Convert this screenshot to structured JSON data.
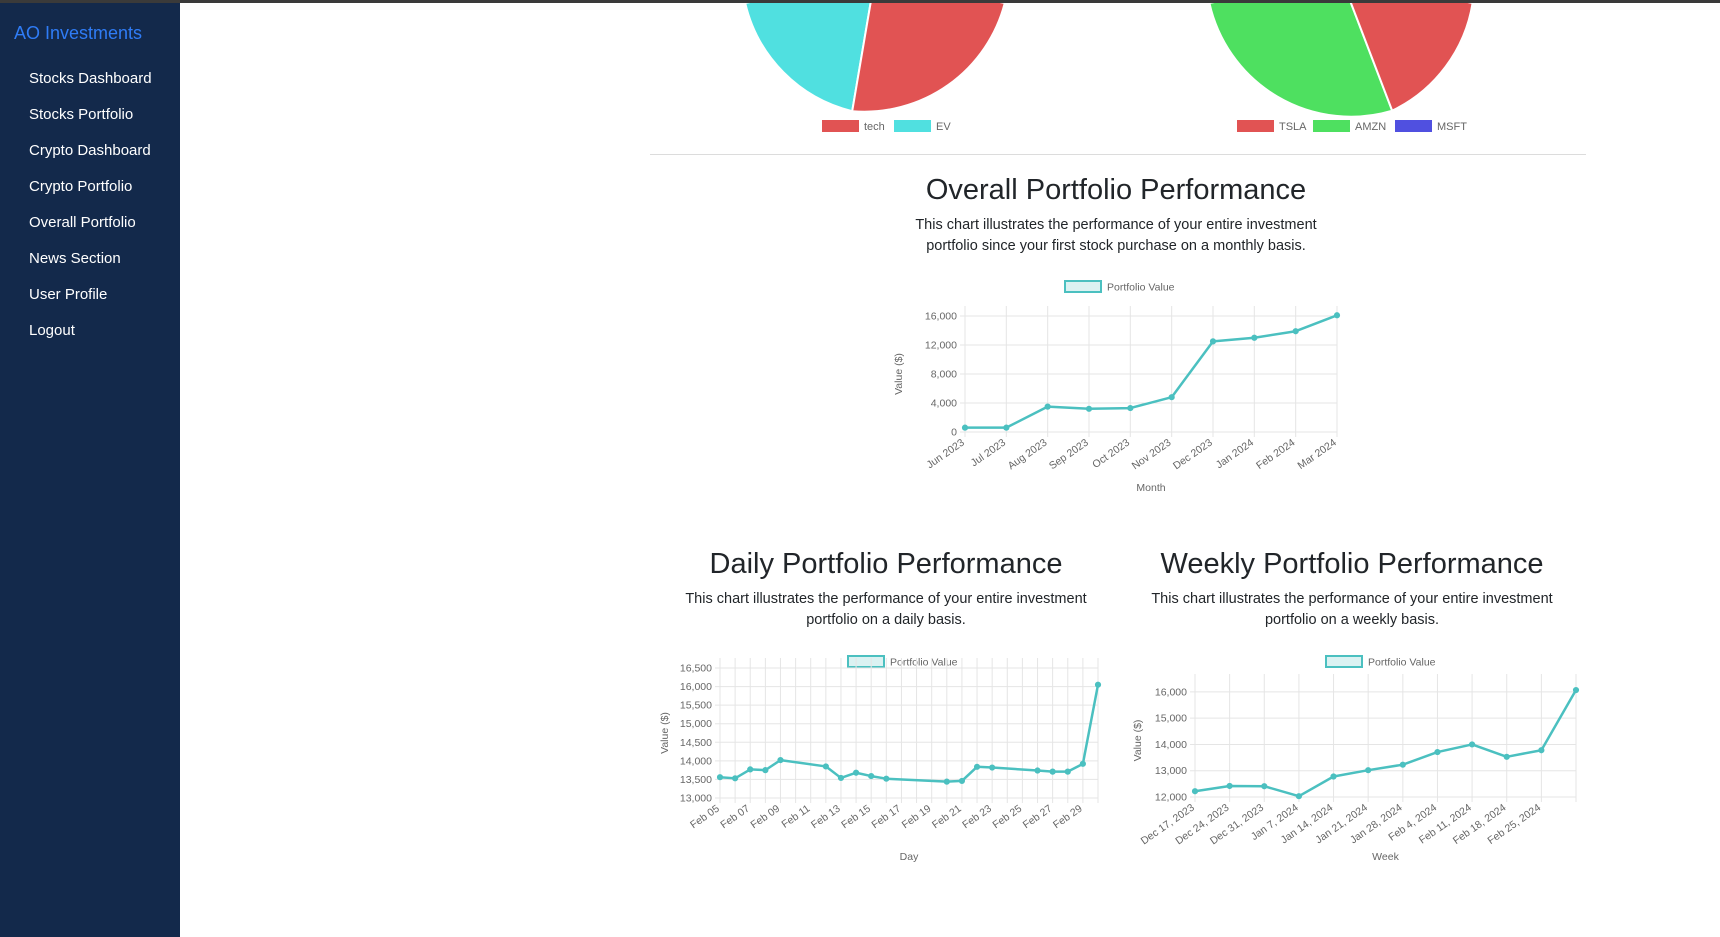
{
  "sidebar": {
    "brand": "AO Investments",
    "items": [
      {
        "label": "Stocks Dashboard"
      },
      {
        "label": "Stocks Portfolio"
      },
      {
        "label": "Crypto Dashboard"
      },
      {
        "label": "Crypto Portfolio"
      },
      {
        "label": "Overall Portfolio"
      },
      {
        "label": "News Section"
      },
      {
        "label": "User Profile"
      },
      {
        "label": "Logout"
      }
    ]
  },
  "colors": {
    "sidebar_bg": "#13294b",
    "brand": "#2f7cf6",
    "line": "#4bc0c0",
    "pie_red": "#e15353",
    "pie_cyan": "#50e0e0",
    "pie_green": "#4ee060",
    "pie_blue": "#5050e0"
  },
  "pie_legends": {
    "left": [
      {
        "label": "tech",
        "color": "#e15353"
      },
      {
        "label": "EV",
        "color": "#50e0e0"
      }
    ],
    "right": [
      {
        "label": "TSLA",
        "color": "#e15353"
      },
      {
        "label": "AMZN",
        "color": "#4ee060"
      },
      {
        "label": "MSFT",
        "color": "#5050e0"
      }
    ]
  },
  "sections": {
    "overall": {
      "title": "Overall Portfolio Performance",
      "desc": "This chart illustrates the performance of your entire investment portfolio since your first stock purchase on a monthly basis."
    },
    "daily": {
      "title": "Daily Portfolio Performance",
      "desc": "This chart illustrates the performance of your entire investment portfolio on a daily basis."
    },
    "weekly": {
      "title": "Weekly Portfolio Performance",
      "desc": "This chart illustrates the performance of your entire investment portfolio on a weekly basis."
    }
  },
  "chart_data": [
    {
      "type": "line",
      "legend": "Portfolio Value",
      "xlabel": "Month",
      "ylabel": "Value ($)",
      "ylim": [
        0,
        16000
      ],
      "yticks": [
        0,
        4000,
        8000,
        12000,
        16000
      ],
      "ytick_labels": [
        "0",
        "4,000",
        "8,000",
        "12,000",
        "16,000"
      ],
      "categories": [
        "Jun 2023",
        "Jul 2023",
        "Aug 2023",
        "Sep 2023",
        "Oct 2023",
        "Nov 2023",
        "Dec 2023",
        "Jan 2024",
        "Feb 2024",
        "Mar 2024"
      ],
      "values": [
        600,
        600,
        3500,
        3200,
        3300,
        4800,
        12500,
        13000,
        13900,
        16100
      ]
    },
    {
      "type": "line",
      "legend": "Portfolio Value",
      "xlabel": "Day",
      "ylabel": "Value ($)",
      "ylim": [
        13000,
        16500
      ],
      "yticks": [
        13000,
        13500,
        14000,
        14500,
        15000,
        15500,
        16000,
        16500
      ],
      "ytick_labels": [
        "13,000",
        "13,500",
        "14,000",
        "14,500",
        "15,000",
        "15,500",
        "16,000",
        "16,500"
      ],
      "xtick_labels": [
        "Feb 05",
        "Feb 07",
        "Feb 09",
        "Feb 11",
        "Feb 13",
        "Feb 15",
        "Feb 17",
        "Feb 19",
        "Feb 21",
        "Feb 23",
        "Feb 25",
        "Feb 27",
        "Feb 29"
      ],
      "x_start_day": 5,
      "x_end_day": 30,
      "points": [
        {
          "x": "Feb 05",
          "y": 13560
        },
        {
          "x": "Feb 06",
          "y": 13530
        },
        {
          "x": "Feb 07",
          "y": 13770
        },
        {
          "x": "Feb 08",
          "y": 13750
        },
        {
          "x": "Feb 09",
          "y": 14020
        },
        {
          "x": "Feb 12",
          "y": 13850
        },
        {
          "x": "Feb 13",
          "y": 13540
        },
        {
          "x": "Feb 14",
          "y": 13680
        },
        {
          "x": "Feb 15",
          "y": 13590
        },
        {
          "x": "Feb 16",
          "y": 13520
        },
        {
          "x": "Feb 20",
          "y": 13440
        },
        {
          "x": "Feb 21",
          "y": 13460
        },
        {
          "x": "Feb 22",
          "y": 13840
        },
        {
          "x": "Feb 23",
          "y": 13820
        },
        {
          "x": "Feb 26",
          "y": 13740
        },
        {
          "x": "Feb 27",
          "y": 13710
        },
        {
          "x": "Feb 28",
          "y": 13710
        },
        {
          "x": "Feb 29",
          "y": 13920
        },
        {
          "x": "Mar 01",
          "y": 16050
        }
      ]
    },
    {
      "type": "line",
      "legend": "Portfolio Value",
      "xlabel": "Week",
      "ylabel": "Value ($)",
      "ylim": [
        12000,
        16300
      ],
      "yticks": [
        12000,
        13000,
        14000,
        15000,
        16000
      ],
      "ytick_labels": [
        "12,000",
        "13,000",
        "14,000",
        "15,000",
        "16,000"
      ],
      "xtick_labels": [
        "Dec 17, 2023",
        "Dec 24, 2023",
        "Dec 31, 2023",
        "Jan 7, 2024",
        "Jan 14, 2024",
        "Jan 21, 2024",
        "Jan 28, 2024",
        "Feb 4, 2024",
        "Feb 11, 2024",
        "Feb 18, 2024",
        "Feb 25, 2024"
      ],
      "points_x": [
        "Dec 17, 2023",
        "Dec 24, 2023",
        "Dec 31, 2023",
        "Jan 7, 2024",
        "Jan 14, 2024",
        "Jan 21, 2024",
        "Jan 28, 2024",
        "Feb 4, 2024",
        "Feb 11, 2024",
        "Feb 18, 2024",
        "Feb 25, 2024",
        "Mar 3, 2024"
      ],
      "values": [
        12220,
        12420,
        12410,
        12030,
        12780,
        13020,
        13230,
        13710,
        14000,
        13530,
        13780,
        16070
      ]
    }
  ]
}
